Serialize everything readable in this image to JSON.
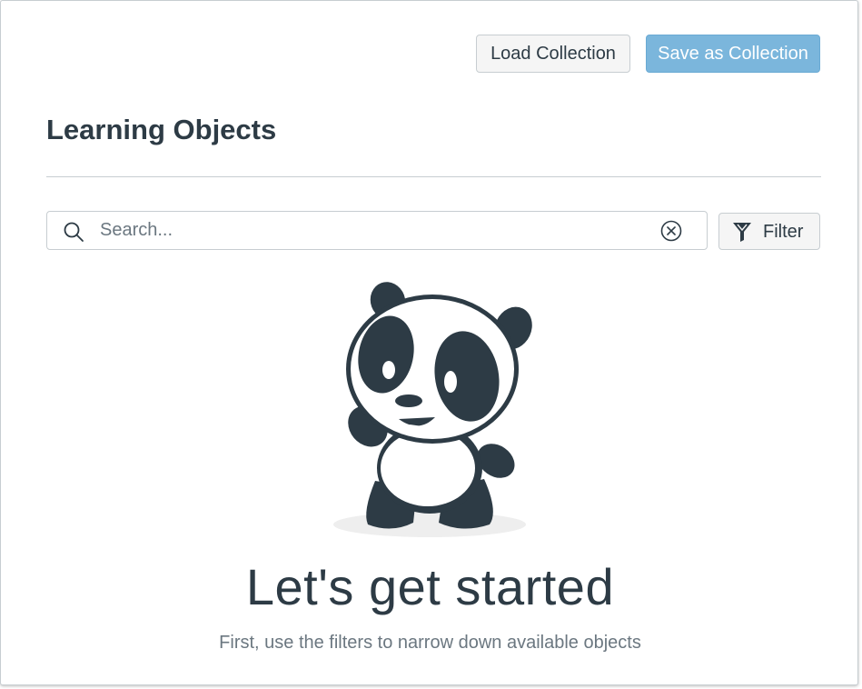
{
  "toolbar": {
    "load_label": "Load Collection",
    "save_label": "Save as Collection"
  },
  "page": {
    "title": "Learning Objects"
  },
  "search": {
    "placeholder": "Search...",
    "value": ""
  },
  "filter": {
    "label": "Filter"
  },
  "empty_state": {
    "headline": "Let's get started",
    "subtext": "First, use the filters to narrow down available objects"
  },
  "icons": {
    "search": "search-icon",
    "clear": "clear-circle-x-icon",
    "filter": "funnel-filter-icon",
    "illustration": "panda-illustration"
  },
  "colors": {
    "primary_button": "#7bb6dc",
    "text": "#2d3b45",
    "muted_text": "#6b7780",
    "border": "#c7cdd1",
    "panda_dark": "#2d3b45"
  }
}
